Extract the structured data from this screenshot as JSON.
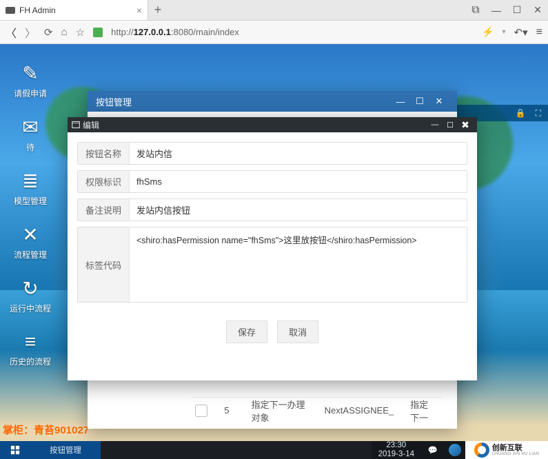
{
  "browser": {
    "tab_title": "FH Admin",
    "url_prefix": "http://",
    "url_host": "127.0.0.1",
    "url_port_path": ":8080/main/index"
  },
  "sidebar": {
    "items": [
      {
        "label": "请假申请",
        "glyph": "✎"
      },
      {
        "label": "待",
        "glyph": "✉"
      },
      {
        "label": "模型管理",
        "glyph": "≣"
      },
      {
        "label": "流程管理",
        "glyph": "✕"
      },
      {
        "label": "运行中流程",
        "glyph": "↻"
      },
      {
        "label": "历史的流程",
        "glyph": "≡"
      }
    ]
  },
  "shopkeeper": "掌柜：青苔901027",
  "window1": {
    "title": "按钮管理"
  },
  "window2": {
    "title": "编辑",
    "fields": {
      "name_label": "按钮名称",
      "name_value": "发站内信",
      "perm_label": "权限标识",
      "perm_value": "fhSms",
      "desc_label": "备注说明",
      "desc_value": "发站内信按钮",
      "code_label": "标签代码",
      "code_value": "<shiro:hasPermission name=\"fhSms\">这里放按钮</shiro:hasPermission>"
    },
    "save": "保存",
    "cancel": "取消"
  },
  "peek_row": {
    "num": "5",
    "c1": "指定下一办理对象",
    "c2": "NextASSIGNEE_",
    "c3": "指定下一"
  },
  "taskbar": {
    "item": "按钮管理",
    "time": "23:30",
    "date": "2019-3-14",
    "logo_cn": "创新互联",
    "logo_en": "CHUANG XIN HU LIAN"
  }
}
